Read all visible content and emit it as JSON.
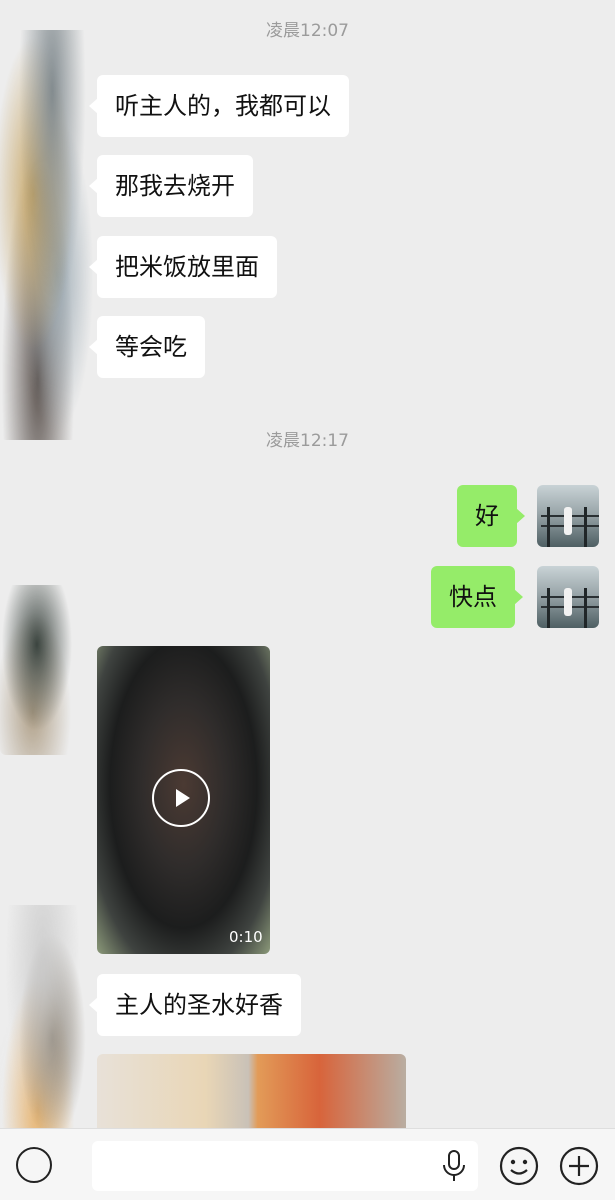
{
  "timestamps": [
    "凌晨12:07",
    "凌晨12:17"
  ],
  "messages": [
    {
      "side": "left",
      "text": "听主人的，我都可以"
    },
    {
      "side": "left",
      "text": "那我去烧开"
    },
    {
      "side": "left",
      "text": "把米饭放里面"
    },
    {
      "side": "left",
      "text": "等会吃"
    },
    {
      "side": "right",
      "text": "好"
    },
    {
      "side": "right",
      "text": "快点"
    },
    {
      "side": "left",
      "type": "video",
      "duration": "0:10"
    },
    {
      "side": "left",
      "text": "主人的圣水好香"
    },
    {
      "side": "left",
      "type": "image"
    }
  ],
  "icons": [
    "voice-icon",
    "emoji-icon",
    "plus-icon"
  ],
  "colors": {
    "background": "#ededed",
    "sent_bubble": "#95ec69",
    "received_bubble": "#ffffff"
  }
}
